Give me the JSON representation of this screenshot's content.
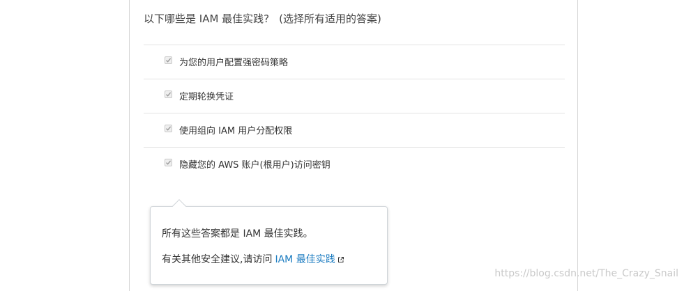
{
  "question": {
    "text": "以下哪些是 IAM 最佳实践?",
    "hint": "(选择所有适用的答案)"
  },
  "options": [
    {
      "label": "为您的用户配置强密码策略",
      "checked": true
    },
    {
      "label": "定期轮换凭证",
      "checked": true
    },
    {
      "label": "使用组向 IAM 用户分配权限",
      "checked": true
    },
    {
      "label": "隐藏您的 AWS 账户(根用户)访问密钥",
      "checked": true
    }
  ],
  "tooltip": {
    "line1": "所有这些答案都是 IAM 最佳实践。",
    "line2_prefix": "有关其他安全建议,请访问",
    "link_label": "IAM 最佳实践"
  },
  "watermark": "https://blog.csdn.net/The_Crazy_Snail",
  "colors": {
    "link": "#1a7bc0",
    "divider": "#e3e3e3",
    "watermark": "#c9c9c9"
  }
}
